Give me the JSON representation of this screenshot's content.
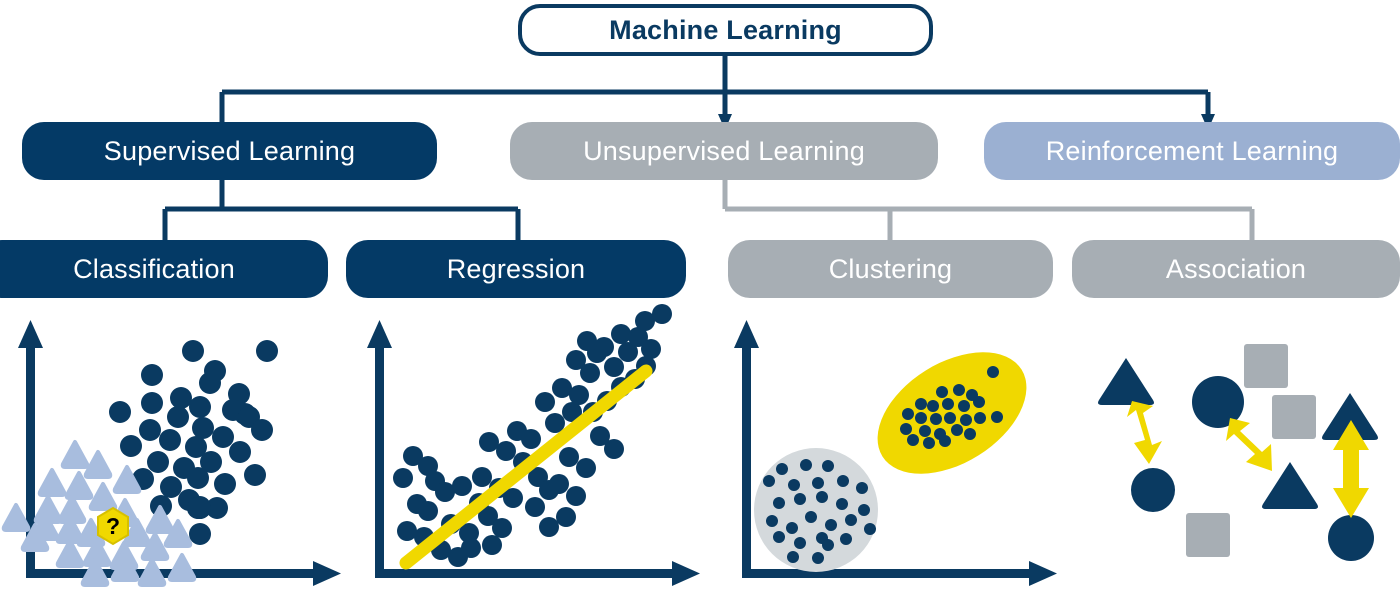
{
  "diagram": {
    "title": "Machine Learning",
    "palette": {
      "navy": "#043a66",
      "navy_outline": "#0a3a61",
      "gray": "#a7aeb4",
      "periwinkle": "#9bb0d2",
      "yellow": "#f0d800",
      "light_triangle": "#a8bdde",
      "light_cluster": "#d4d9dc",
      "white": "#ffffff",
      "black": "#000000"
    },
    "root": {
      "label": "Machine Learning",
      "style": "outlined-navy"
    },
    "level1": [
      {
        "label": "Supervised Learning",
        "style": "navy"
      },
      {
        "label": "Unsupervised Learning",
        "style": "gray"
      },
      {
        "label": "Reinforcement Learning",
        "style": "periwinkle"
      }
    ],
    "level2": [
      {
        "label": "Classification",
        "style": "navy",
        "parent": "Supervised Learning"
      },
      {
        "label": "Regression",
        "style": "navy",
        "parent": "Supervised Learning"
      },
      {
        "label": "Clustering",
        "style": "gray",
        "parent": "Unsupervised Learning"
      },
      {
        "label": "Association",
        "style": "gray",
        "parent": "Unsupervised Learning"
      }
    ]
  },
  "illustrations": [
    {
      "name": "classification-plot",
      "for": "Classification",
      "has_axes": true,
      "description": "Two labelled groups: dark blue circles upper right, light blue triangles lower left, one unknown yellow hexagon marked with a question mark",
      "unknown_marker": "?"
    },
    {
      "name": "regression-plot",
      "for": "Regression",
      "has_axes": true,
      "description": "Scatter of dark blue circles with a thick yellow best-fit line rising left to right"
    },
    {
      "name": "clustering-plot",
      "for": "Clustering",
      "has_axes": true,
      "description": "Two groups of small dark blue dots enclosed by a light gray circle and a yellow tilted ellipse"
    },
    {
      "name": "association-plot",
      "for": "Association",
      "has_axes": false,
      "description": "Dark blue triangles and circles plus gray squares linked in pairs by yellow double-headed arrows"
    }
  ],
  "chart_data": {
    "type": "scatter",
    "title": "Machine Learning",
    "panels": [
      {
        "name": "Classification",
        "xlabel": "",
        "ylabel": "",
        "series": [
          {
            "name": "class-a-circles",
            "marker": "circle",
            "color": "#0a3a61",
            "points": [
              [
                0.42,
                0.93
              ],
              [
                0.66,
                0.93
              ],
              [
                0.3,
                0.8
              ],
              [
                0.44,
                0.79
              ],
              [
                0.51,
                0.78
              ],
              [
                0.3,
                0.72
              ],
              [
                0.37,
                0.73
              ],
              [
                0.42,
                0.72
              ],
              [
                0.54,
                0.72
              ],
              [
                0.63,
                0.72
              ],
              [
                0.22,
                0.67
              ],
              [
                0.3,
                0.65
              ],
              [
                0.38,
                0.64
              ],
              [
                0.49,
                0.64
              ],
              [
                0.6,
                0.63
              ],
              [
                0.34,
                0.59
              ],
              [
                0.41,
                0.58
              ],
              [
                0.5,
                0.58
              ],
              [
                0.24,
                0.54
              ],
              [
                0.31,
                0.52
              ],
              [
                0.37,
                0.52
              ],
              [
                0.46,
                0.52
              ],
              [
                0.53,
                0.52
              ],
              [
                0.3,
                0.45
              ],
              [
                0.36,
                0.45
              ],
              [
                0.45,
                0.44
              ],
              [
                0.4,
                0.34
              ]
            ]
          },
          {
            "name": "class-b-triangles",
            "marker": "triangle",
            "color": "#a8bdde",
            "points": [
              [
                0.13,
                0.44
              ],
              [
                0.08,
                0.39
              ],
              [
                0.14,
                0.36
              ],
              [
                0.18,
                0.4
              ],
              [
                0.23,
                0.38
              ],
              [
                0.04,
                0.31
              ],
              [
                0.1,
                0.32
              ],
              [
                0.16,
                0.3
              ],
              [
                0.2,
                0.33
              ],
              [
                0.26,
                0.3
              ],
              [
                0.06,
                0.25
              ],
              [
                0.12,
                0.24
              ],
              [
                0.18,
                0.25
              ],
              [
                0.24,
                0.26
              ],
              [
                0.29,
                0.25
              ],
              [
                0.1,
                0.19
              ],
              [
                0.15,
                0.18
              ],
              [
                0.21,
                0.19
              ],
              [
                0.26,
                0.18
              ],
              [
                0.31,
                0.2
              ],
              [
                0.14,
                0.12
              ],
              [
                0.2,
                0.11
              ],
              [
                0.25,
                0.13
              ],
              [
                0.3,
                0.1
              ],
              [
                0.34,
                0.13
              ]
            ]
          },
          {
            "name": "unknown-sample",
            "marker": "hexagon",
            "color": "#f0d800",
            "label": "?",
            "points": [
              [
                0.195,
                0.235
              ]
            ]
          }
        ]
      },
      {
        "name": "Regression",
        "xlabel": "",
        "ylabel": "",
        "series": [
          {
            "name": "observations",
            "marker": "circle",
            "color": "#0a3a61",
            "points": [
              [
                0.08,
                0.43
              ],
              [
                0.12,
                0.4
              ],
              [
                0.05,
                0.36
              ],
              [
                0.14,
                0.35
              ],
              [
                0.09,
                0.28
              ],
              [
                0.12,
                0.26
              ],
              [
                0.06,
                0.2
              ],
              [
                0.11,
                0.18
              ],
              [
                0.16,
                0.14
              ],
              [
                0.21,
                0.12
              ],
              [
                0.19,
                0.22
              ],
              [
                0.24,
                0.19
              ],
              [
                0.17,
                0.31
              ],
              [
                0.22,
                0.33
              ],
              [
                0.27,
                0.28
              ],
              [
                0.25,
                0.15
              ],
              [
                0.31,
                0.16
              ],
              [
                0.3,
                0.25
              ],
              [
                0.34,
                0.21
              ],
              [
                0.28,
                0.36
              ],
              [
                0.33,
                0.33
              ],
              [
                0.37,
                0.3
              ],
              [
                0.35,
                0.44
              ],
              [
                0.4,
                0.41
              ],
              [
                0.3,
                0.47
              ],
              [
                0.38,
                0.5
              ],
              [
                0.42,
                0.48
              ],
              [
                0.44,
                0.37
              ],
              [
                0.47,
                0.33
              ],
              [
                0.43,
                0.28
              ],
              [
                0.47,
                0.22
              ],
              [
                0.52,
                0.25
              ],
              [
                0.5,
                0.35
              ],
              [
                0.55,
                0.31
              ],
              [
                0.53,
                0.42
              ],
              [
                0.58,
                0.39
              ],
              [
                0.49,
                0.52
              ],
              [
                0.54,
                0.55
              ],
              [
                0.46,
                0.58
              ],
              [
                0.51,
                0.62
              ],
              [
                0.56,
                0.6
              ],
              [
                0.6,
                0.55
              ],
              [
                0.62,
                0.48
              ],
              [
                0.66,
                0.44
              ],
              [
                0.64,
                0.58
              ],
              [
                0.59,
                0.66
              ],
              [
                0.55,
                0.7
              ],
              [
                0.61,
                0.72
              ],
              [
                0.66,
                0.68
              ],
              [
                0.68,
                0.62
              ],
              [
                0.58,
                0.78
              ],
              [
                0.63,
                0.76
              ],
              [
                0.7,
                0.74
              ],
              [
                0.72,
                0.66
              ],
              [
                0.75,
                0.7
              ],
              [
                0.69,
                0.81
              ],
              [
                0.74,
                0.8
              ],
              [
                0.78,
                0.76
              ],
              [
                0.76,
                0.86
              ],
              [
                0.81,
                0.88
              ]
            ]
          },
          {
            "name": "fit-line",
            "marker": "line",
            "color": "#f0d800",
            "points": [
              [
                0.03,
                0.07
              ],
              [
                0.86,
                0.9
              ]
            ]
          }
        ]
      },
      {
        "name": "Clustering",
        "xlabel": "",
        "ylabel": "",
        "series": [
          {
            "name": "cluster-1",
            "hull": "circle",
            "hull_color": "#d4d9dc",
            "marker": "dot",
            "color": "#0a3a61",
            "points": [
              [
                0.12,
                0.4
              ],
              [
                0.18,
                0.46
              ],
              [
                0.25,
                0.47
              ],
              [
                0.09,
                0.34
              ],
              [
                0.16,
                0.36
              ],
              [
                0.22,
                0.33
              ],
              [
                0.28,
                0.38
              ],
              [
                0.33,
                0.35
              ],
              [
                0.13,
                0.28
              ],
              [
                0.19,
                0.3
              ],
              [
                0.24,
                0.28
              ],
              [
                0.3,
                0.24
              ],
              [
                0.35,
                0.27
              ],
              [
                0.1,
                0.22
              ],
              [
                0.16,
                0.2
              ],
              [
                0.21,
                0.18
              ],
              [
                0.26,
                0.22
              ],
              [
                0.31,
                0.19
              ],
              [
                0.36,
                0.23
              ],
              [
                0.14,
                0.14
              ],
              [
                0.2,
                0.12
              ],
              [
                0.26,
                0.15
              ],
              [
                0.31,
                0.11
              ],
              [
                0.18,
                0.08
              ],
              [
                0.24,
                0.09
              ]
            ]
          },
          {
            "name": "cluster-2",
            "hull": "ellipse",
            "hull_color": "#f0d800",
            "marker": "dot",
            "color": "#0a3a61",
            "points": [
              [
                0.72,
                0.83
              ],
              [
                0.6,
                0.74
              ],
              [
                0.65,
                0.73
              ],
              [
                0.69,
                0.71
              ],
              [
                0.54,
                0.7
              ],
              [
                0.58,
                0.67
              ],
              [
                0.63,
                0.68
              ],
              [
                0.67,
                0.65
              ],
              [
                0.71,
                0.67
              ],
              [
                0.49,
                0.64
              ],
              [
                0.53,
                0.62
              ],
              [
                0.57,
                0.63
              ],
              [
                0.62,
                0.61
              ],
              [
                0.66,
                0.6
              ],
              [
                0.7,
                0.62
              ],
              [
                0.74,
                0.64
              ],
              [
                0.46,
                0.57
              ],
              [
                0.52,
                0.55
              ],
              [
                0.56,
                0.56
              ],
              [
                0.6,
                0.54
              ],
              [
                0.64,
                0.55
              ],
              [
                0.51,
                0.51
              ],
              [
                0.55,
                0.52
              ],
              [
                0.59,
                0.5
              ]
            ]
          }
        ]
      },
      {
        "name": "Association",
        "xlabel": "",
        "ylabel": "",
        "series": [
          {
            "name": "triangles",
            "marker": "triangle",
            "color": "#0a3a61",
            "points": [
              [
                0.14,
                0.82
              ],
              [
                0.63,
                0.41
              ],
              [
                0.83,
                0.68
              ]
            ]
          },
          {
            "name": "circles",
            "marker": "circle",
            "color": "#0a3a61",
            "points": [
              [
                0.21,
                0.4
              ],
              [
                0.41,
                0.71
              ],
              [
                0.86,
                0.22
              ]
            ]
          },
          {
            "name": "squares",
            "marker": "square",
            "color": "#a7aeb4",
            "points": [
              [
                0.54,
                0.88
              ],
              [
                0.63,
                0.7
              ],
              [
                0.36,
                0.26
              ]
            ]
          },
          {
            "name": "association-arrows",
            "marker": "double-arrow",
            "color": "#f0d800",
            "pairs": [
              [
                [
                  0.16,
                  0.72
                ],
                [
                  0.2,
                  0.5
                ]
              ],
              [
                [
                  0.45,
                  0.63
                ],
                [
                  0.58,
                  0.49
                ]
              ],
              [
                [
                  0.84,
                  0.6
                ],
                [
                  0.85,
                  0.32
                ]
              ]
            ]
          }
        ]
      }
    ]
  }
}
